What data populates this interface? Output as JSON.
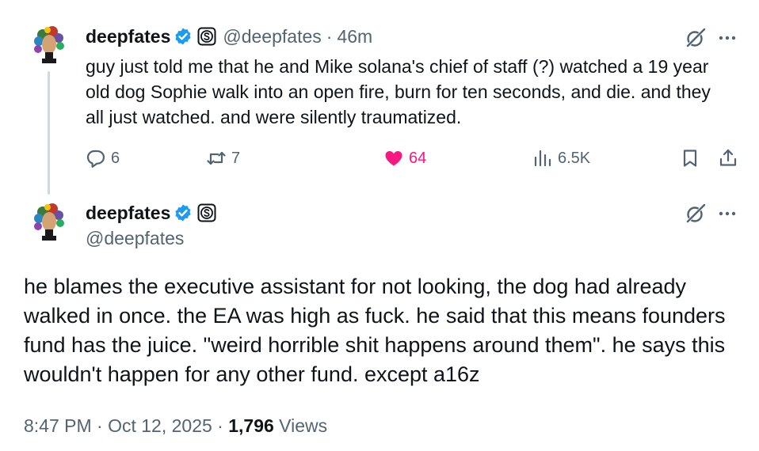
{
  "tweet1": {
    "display_name": "deepfates",
    "handle": "@deepfates",
    "separator": "·",
    "time_ago": "46m",
    "text": "guy just told me that he and Mike solana's chief of staff (?) watched a 19 year old dog Sophie walk into an open fire, burn for ten seconds, and die. and they all just watched. and were silently traumatized.",
    "replies": "6",
    "reposts": "7",
    "likes": "64",
    "views": "6.5K"
  },
  "tweet2": {
    "display_name": "deepfates",
    "handle": "@deepfates",
    "text": "he blames the executive assistant for not looking, the dog had already walked in once. the EA was high as fuck. he said that this means founders fund has the juice. \"weird horrible shit happens around them\". he says this wouldn't happen for any other fund. except a16z",
    "timestamp": "8:47 PM · Oct 12, 2025 · ",
    "views_count": "1,796",
    "views_label": " Views"
  },
  "colors": {
    "text_primary": "#0f1419",
    "text_secondary": "#536471",
    "like_pink": "#f91880",
    "verified_blue": "#1d9bf0",
    "thread_line": "#cfd9de"
  },
  "icons": {
    "verified": "verified-badge-icon",
    "affiliation": "affiliation-badge-icon",
    "grok": "grok-icon",
    "more": "more-icon",
    "reply": "reply-icon",
    "repost": "repost-icon",
    "like": "like-icon",
    "views": "views-icon",
    "bookmark": "bookmark-icon",
    "share": "share-icon"
  }
}
